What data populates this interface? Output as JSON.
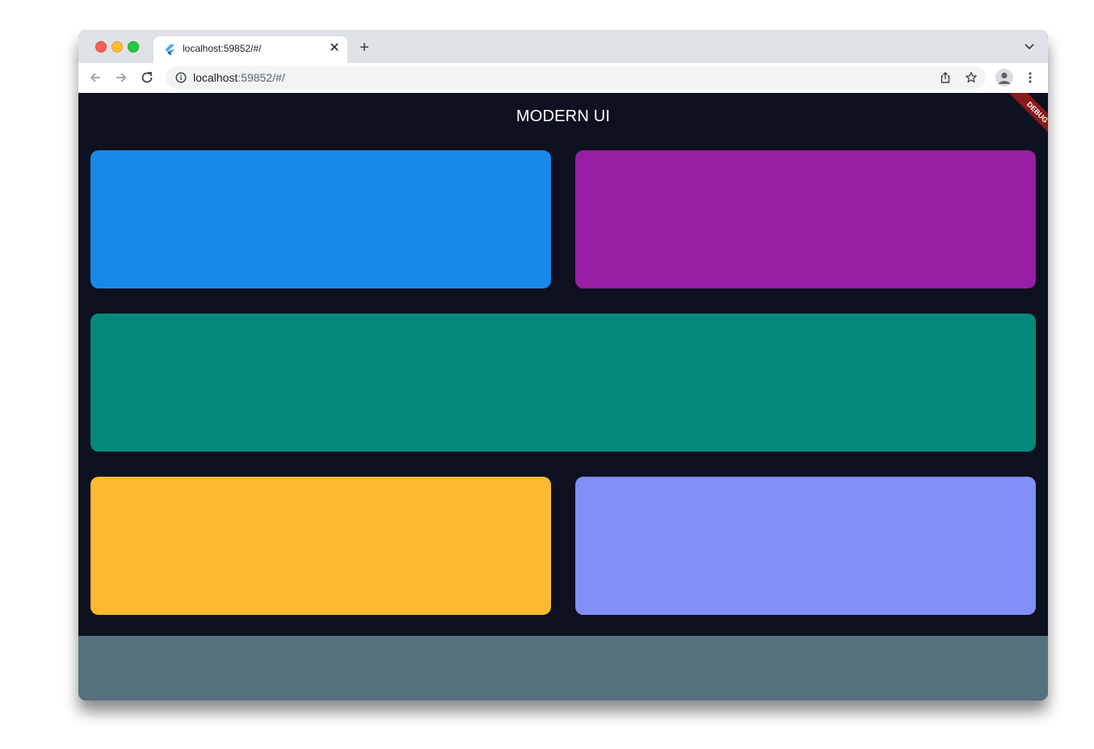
{
  "browser": {
    "tab": {
      "title": "localhost:59852/#/",
      "close_glyph": "✕",
      "favicon": "flutter-icon"
    },
    "new_tab_glyph": "+",
    "address_bar": {
      "host": "localhost",
      "rest": ":59852/#/"
    },
    "icons": [
      "back-arrow-icon",
      "forward-arrow-icon",
      "reload-icon",
      "info-icon",
      "share-icon",
      "star-icon",
      "profile-icon",
      "more-menu-icon",
      "tab-search-icon"
    ]
  },
  "app": {
    "title": "MODERN UI",
    "debug_banner": "DEBUG",
    "background": "#0e1120",
    "cards": [
      {
        "color": "#1889eb"
      },
      {
        "color": "#981ea3"
      },
      {
        "color": "#03897a"
      },
      {
        "color": "#fdb92f"
      },
      {
        "color": "#818ff7"
      }
    ],
    "footer_color": "#56717e"
  }
}
